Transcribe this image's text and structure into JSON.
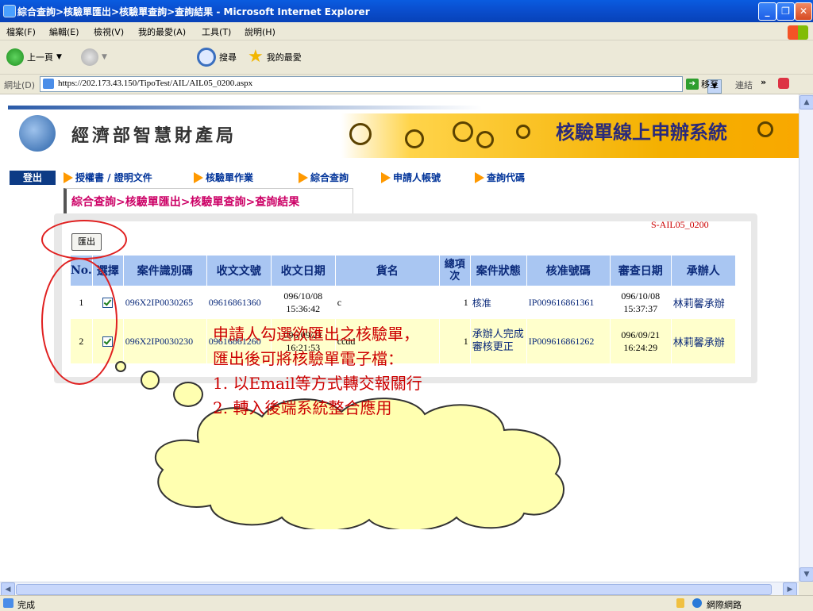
{
  "window": {
    "title": "綜合查詢>核驗單匯出>核驗單查詢>查詢結果 - Microsoft Internet Explorer"
  },
  "menu": [
    "檔案(F)",
    "編輯(E)",
    "檢視(V)",
    "我的最愛(A)",
    "工具(T)",
    "說明(H)"
  ],
  "toolbar": {
    "back": "上一頁",
    "search": "搜尋",
    "favorites": "我的最愛"
  },
  "address": {
    "label": "網址(D)",
    "url": "https://202.173.43.150/TipoTest/AIL/AIL05_0200.aspx",
    "go": "移至",
    "links": "連結"
  },
  "banner": {
    "agency": "經濟部智慧財產局",
    "system": "核驗單線上申辦系統"
  },
  "nav": {
    "logout": "登出",
    "items": [
      "授權書 / 證明文件",
      "核驗單作業",
      "綜合查詢",
      "申請人帳號",
      "查詢代碼"
    ]
  },
  "page": {
    "breadcrumb": "綜合查詢>核驗單匯出>核驗單查詢>查詢結果",
    "page_id": "S-AIL05_0200",
    "export_label": "匯出"
  },
  "table": {
    "headers": [
      "No.",
      "選擇",
      "案件識別碼",
      "收文文號",
      "收文日期",
      "貨名",
      "總項次",
      "案件狀態",
      "核准號碼",
      "審查日期",
      "承辦人"
    ],
    "rows": [
      {
        "no": "1",
        "checked": true,
        "case_id": "096X2IP0030265",
        "doc_no": "09616861360",
        "recv_date": "096/10/08",
        "recv_time": "15:36:42",
        "goods": "c",
        "total_items": "1",
        "status": "核准",
        "approval_no": "IP009616861361",
        "review_date": "096/10/08",
        "review_time": "15:37:37",
        "handler": "林莉馨承辦"
      },
      {
        "no": "2",
        "checked": true,
        "case_id": "096X2IP0030230",
        "doc_no": "09616861260",
        "recv_date": "096/09/21",
        "recv_time": "16:21:53",
        "goods": "ccdd",
        "total_items": "1",
        "status": "承辦人完成審核更正",
        "approval_no": "IP009616861262",
        "review_date": "096/09/21",
        "review_time": "16:24:29",
        "handler": "林莉馨承辦"
      }
    ]
  },
  "callout": {
    "line1": "申請人勾選欲匯出之核驗單，",
    "line2": "匯出後可將核驗單電子檔：",
    "line3": "1. 以Email等方式轉交報關行",
    "line4": "2. 轉入後端系統整合應用"
  },
  "status": {
    "text": "完成",
    "zone": "網際網路"
  },
  "colors": {
    "accent_red": "#cc0000",
    "header_blue": "#a9c6f2",
    "row_yellow": "#ffffcc",
    "nav_orange": "#ff9900"
  }
}
